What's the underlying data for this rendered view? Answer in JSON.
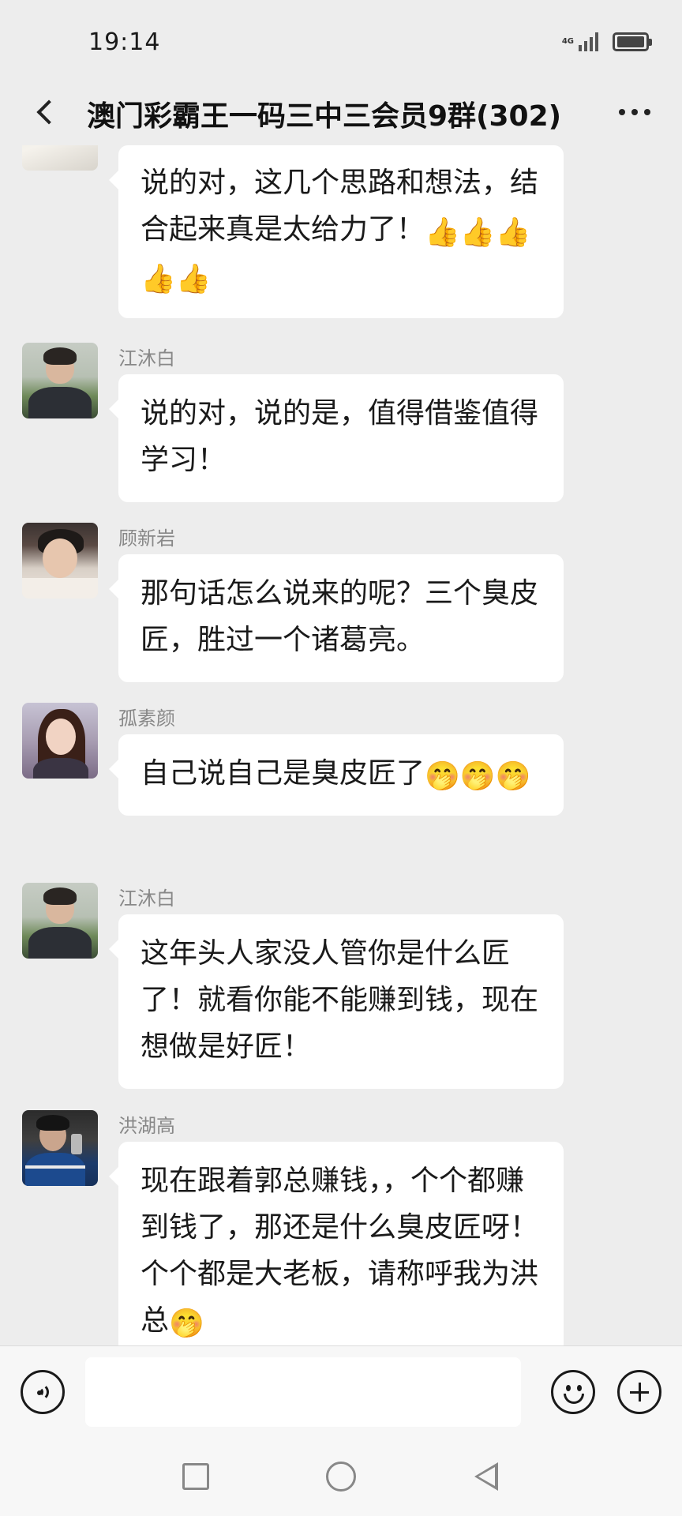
{
  "status_bar": {
    "time": "19:14",
    "network": "4G"
  },
  "header": {
    "title": "澳门彩霸王一码三中三会员9群(302)"
  },
  "messages": [
    {
      "sender": "",
      "avatar": "avatar-light",
      "text": "说的对，这几个思路和想法，结合起来真是太给力了！",
      "emojis": [
        "👍",
        "👍",
        "👍",
        "👍",
        "👍"
      ]
    },
    {
      "sender": "江沐白",
      "avatar": "avatar-boy-field",
      "text": "说的对，说的是，值得借鉴值得学习！",
      "emojis": []
    },
    {
      "sender": "顾新岩",
      "avatar": "avatar-boy-lying",
      "text": "那句话怎么说来的呢？三个臭皮匠，胜过一个诸葛亮。",
      "emojis": []
    },
    {
      "sender": "孤素颜",
      "avatar": "avatar-girl",
      "text": "自己说自己是臭皮匠了",
      "emojis": [
        "🤭",
        "🤭",
        "🤭"
      ]
    },
    {
      "sender": "江沐白",
      "avatar": "avatar-boy-field",
      "text": "这年头人家没人管你是什么匠了！就看你能不能赚到钱，现在想做是好匠！",
      "emojis": []
    },
    {
      "sender": "洪湖高",
      "avatar": "avatar-blue",
      "text": "现在跟着郭总赚钱，，个个都赚到钱了，那还是什么臭皮匠呀！个个都是大老板，请称呼我为洪总",
      "emojis": [
        "🤭"
      ]
    }
  ],
  "input_bar": {
    "value": "",
    "placeholder": "",
    "icons": [
      "voice-icon",
      "emoji-icon",
      "plus-icon"
    ]
  },
  "nav_bar": {
    "icons": [
      "recent-apps-icon",
      "home-icon",
      "back-icon"
    ]
  },
  "colors": {
    "background": "#ededed",
    "bubble": "#ffffff",
    "sender_name": "#888888"
  }
}
